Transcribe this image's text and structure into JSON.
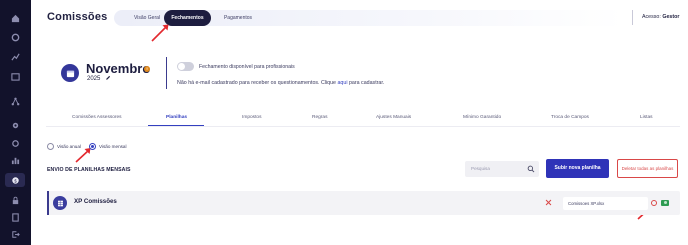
{
  "header": {
    "title": "Comissões",
    "tabs": [
      {
        "label": "Visão Geral",
        "active": false
      },
      {
        "label": "Fechamentos",
        "active": true
      },
      {
        "label": "Pagamentos",
        "active": false
      }
    ],
    "access_label": "Acesso:",
    "access_value": "Gestor"
  },
  "sidebar": {
    "icons": [
      "home-icon",
      "settings-icon",
      "chart-icon",
      "calendar-icon",
      "network-icon",
      "gear-icon",
      "gear-small-icon",
      "report-icon",
      "bar-chart-icon",
      "commissions-icon",
      "lock-icon",
      "document-icon",
      "logout-icon"
    ],
    "active_index": 9
  },
  "period": {
    "month": "Novembro",
    "year": "2025",
    "toggle_label": "Fechamento disponível para profissionais",
    "toggle_on": false,
    "info_before": "Não há e-mail cadastrado para receber os questionamentos. Clique",
    "info_link": "aqui",
    "info_after": "para cadastrar."
  },
  "subtabs": [
    {
      "label": "Comissões Assessores"
    },
    {
      "label": "Planilhas"
    },
    {
      "label": "Impostos"
    },
    {
      "label": "Regras"
    },
    {
      "label": "Ajustes Manuais"
    },
    {
      "label": "Mínimo Garantido"
    },
    {
      "label": "Troca de Campos"
    },
    {
      "label": "Listas"
    }
  ],
  "active_subtab": "Planilhas",
  "view": {
    "options": [
      {
        "label": "Visão anual",
        "checked": false
      },
      {
        "label": "Visão mensal",
        "checked": true
      }
    ]
  },
  "upload": {
    "title": "ENVIO DE PLANILHAS MENSAIS",
    "search_placeholder": "Pesquisa",
    "submit_label": "Subir nova planilha",
    "delete_label": "Deletar todas as planilhas"
  },
  "sheets": [
    {
      "name": "XP Comissões",
      "file": "Comissoes XP.xlsx"
    }
  ],
  "colors": {
    "sidebar": "#12122b",
    "primary": "#2f33b8",
    "danger": "#d94848",
    "arrow": "#e3282e"
  }
}
